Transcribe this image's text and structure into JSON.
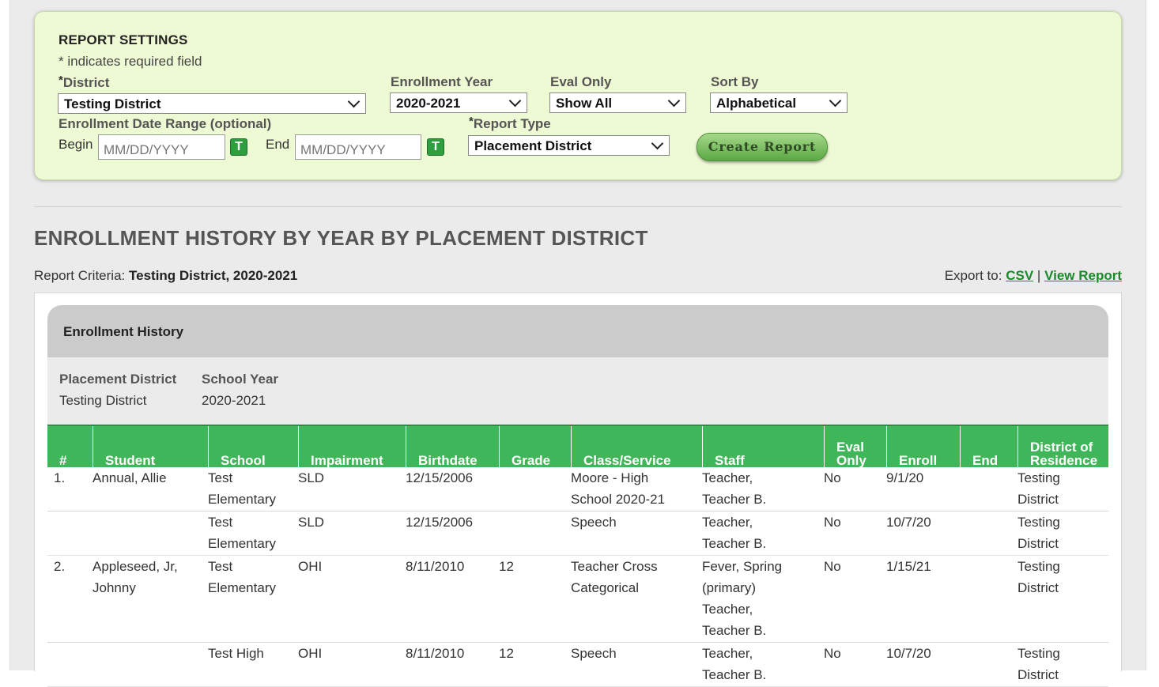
{
  "settings": {
    "title": "REPORT SETTINGS",
    "required_note": "* indicates required field",
    "district": {
      "label_star": "*",
      "label": "District",
      "value": "Testing District"
    },
    "enrollment_year": {
      "label": "Enrollment Year",
      "value": "2020-2021"
    },
    "eval_only": {
      "label": "Eval Only",
      "value": "Show All"
    },
    "sort_by": {
      "label": "Sort By",
      "value": "Alphabetical"
    },
    "date_range": {
      "label": "Enrollment Date Range (optional)",
      "begin_label": "Begin",
      "end_label": "End",
      "begin_placeholder": "MM/DD/YYYY",
      "end_placeholder": "MM/DD/YYYY",
      "calendar_btn": "T"
    },
    "report_type": {
      "label_star": "*",
      "label": "Report Type",
      "value": "Placement District"
    },
    "create_button": "Create Report"
  },
  "report": {
    "title": "ENROLLMENT HISTORY BY YEAR BY PLACEMENT DISTRICT",
    "criteria_label": "Report Criteria:",
    "criteria_value": "Testing District, 2020-2021",
    "export_label": "Export to:",
    "export_csv": "CSV",
    "export_sep": "|",
    "export_view": "View Report",
    "section_title": "Enrollment History",
    "meta": {
      "placement_label": "Placement District",
      "placement_value": "Testing District",
      "year_label": "School Year",
      "year_value": "2020-2021"
    },
    "columns": [
      "#",
      "Student",
      "School",
      "Impairment",
      "Birthdate",
      "Grade",
      "Class/Service",
      "Staff",
      "Eval\nOnly",
      "Enroll",
      "End",
      "District of\nResidence"
    ],
    "rows": [
      {
        "num": "1.",
        "student": "Annual, Allie",
        "school": "Test\nElementary",
        "impairment": "SLD",
        "birthdate": "12/15/2006",
        "grade": "",
        "class": "Moore - High\nSchool 2020-21",
        "staff": "Teacher,\nTeacher B.",
        "eval": "No",
        "enroll": "9/1/20",
        "end": "",
        "district": "Testing\nDistrict"
      },
      {
        "num": "",
        "student": "",
        "school": "Test\nElementary",
        "impairment": "SLD",
        "birthdate": "12/15/2006",
        "grade": "",
        "class": "Speech",
        "staff": "Teacher,\nTeacher B.",
        "eval": "No",
        "enroll": "10/7/20",
        "end": "",
        "district": "Testing\nDistrict"
      },
      {
        "num": "2.",
        "student": "Appleseed, Jr,\nJohnny",
        "school": "Test\nElementary",
        "impairment": "OHI",
        "birthdate": "8/11/2010",
        "grade": "12",
        "class": "Teacher Cross\nCategorical",
        "staff": "Fever, Spring\n(primary)\nTeacher,\nTeacher B.",
        "eval": "No",
        "enroll": "1/15/21",
        "end": "",
        "district": "Testing\nDistrict"
      },
      {
        "num": "",
        "student": "",
        "school": "Test High",
        "impairment": "OHI",
        "birthdate": "8/11/2010",
        "grade": "12",
        "class": "Speech",
        "staff": "Teacher,\nTeacher B.",
        "eval": "No",
        "enroll": "10/7/20",
        "end": "",
        "district": "Testing\nDistrict"
      }
    ]
  }
}
